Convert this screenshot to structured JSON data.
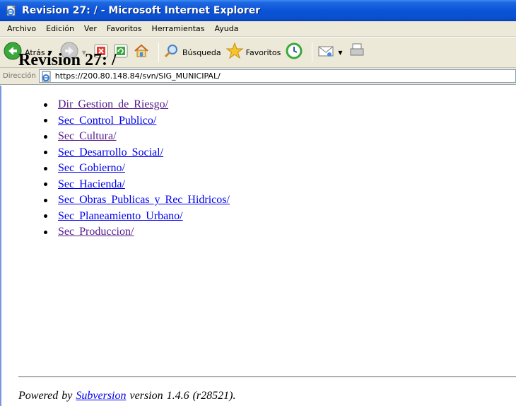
{
  "window": {
    "title": "Revision 27: / - Microsoft Internet Explorer"
  },
  "menubar": {
    "items": [
      "Archivo",
      "Edición",
      "Ver",
      "Favoritos",
      "Herramientas",
      "Ayuda"
    ]
  },
  "toolbar": {
    "back_label": "Atrás",
    "search_label": "Búsqueda",
    "favorites_label": "Favoritos"
  },
  "address": {
    "label": "Dirección",
    "url": "https://200.80.148.84/svn/SIG_MUNICIPAL/"
  },
  "page": {
    "heading": "Revision 27: /",
    "directories": [
      {
        "name": "Dir Gestion de Riesgo/",
        "visited": true
      },
      {
        "name": "Sec Control Publico/",
        "visited": false
      },
      {
        "name": "Sec Cultura/",
        "visited": true
      },
      {
        "name": "Sec Desarrollo Social/",
        "visited": false
      },
      {
        "name": "Sec Gobierno/",
        "visited": false
      },
      {
        "name": "Sec Hacienda/",
        "visited": false
      },
      {
        "name": "Sec Obras Publicas y Rec Hidricos/",
        "visited": false
      },
      {
        "name": "Sec Planeamiento Urbano/",
        "visited": false
      },
      {
        "name": "Sec Produccion/",
        "visited": true
      }
    ],
    "footer": {
      "prefix": "Powered by",
      "link": "Subversion",
      "suffix": "version 1.4.6 (r28521)."
    }
  },
  "colors": {
    "link": "#0000ee",
    "visited_link": "#551a8b",
    "titlebar": "#0a54d8"
  }
}
